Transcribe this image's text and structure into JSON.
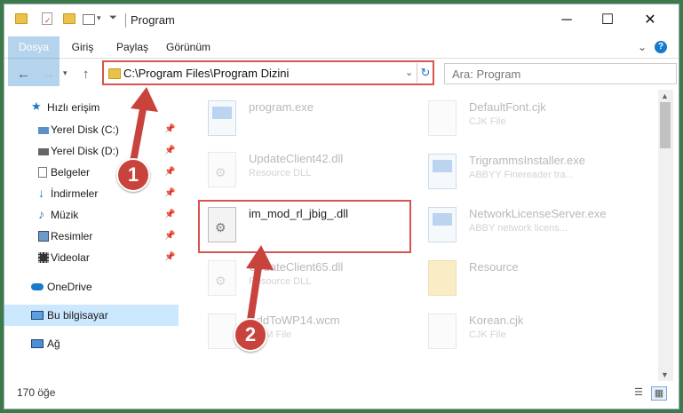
{
  "window": {
    "title": "Program",
    "buttons": {
      "minimize": "─",
      "maximize": "☐",
      "close": "✕"
    }
  },
  "ribbon": {
    "tabs": [
      {
        "label": "Dosya"
      },
      {
        "label": "Giriş"
      },
      {
        "label": "Paylaş"
      },
      {
        "label": "Görünüm"
      }
    ],
    "expand_icon": "⌄",
    "help_icon": "?"
  },
  "address": {
    "path": "C:\\Program Files\\Program Dizini",
    "search_placeholder": "Ara: Program"
  },
  "sidebar": {
    "items": [
      {
        "label": "Hızlı erişim",
        "icon": "star-icon"
      },
      {
        "label": "Yerel Disk (C:)",
        "icon": "drive-icon"
      },
      {
        "label": "Yerel Disk (D:)",
        "icon": "drive-icon"
      },
      {
        "label": "Belgeler",
        "icon": "documents-icon"
      },
      {
        "label": "İndirmeler",
        "icon": "download-icon"
      },
      {
        "label": "Müzik",
        "icon": "music-icon"
      },
      {
        "label": "Resimler",
        "icon": "pictures-icon"
      },
      {
        "label": "Videolar",
        "icon": "videos-icon"
      },
      {
        "label": "OneDrive",
        "icon": "cloud-icon"
      },
      {
        "label": "Bu bilgisayar",
        "icon": "computer-icon"
      },
      {
        "label": "Ağ",
        "icon": "network-icon"
      }
    ]
  },
  "files": {
    "left": [
      {
        "name": "program.exe",
        "desc": ""
      },
      {
        "name": "UpdateClient42.dll",
        "desc": "Resource DLL"
      },
      {
        "name": "im_mod_rl_jbig_.dll",
        "desc": ""
      },
      {
        "name": "UpdateClient65.dll",
        "desc": "Resource DLL"
      },
      {
        "name": "AddToWP14.wcm",
        "desc": "WCM File"
      }
    ],
    "right": [
      {
        "name": "DefaultFont.cjk",
        "desc": "CJK File"
      },
      {
        "name": "TrigrammsInstaller.exe",
        "desc": "ABBYY Finereader tra..."
      },
      {
        "name": "NetworkLicenseServer.exe",
        "desc": "ABBY network licens..."
      },
      {
        "name": "Resource",
        "desc": ""
      },
      {
        "name": "Korean.cjk",
        "desc": "CJK File"
      }
    ]
  },
  "status": {
    "count": "170 öğe"
  },
  "callouts": {
    "one": "1",
    "two": "2"
  },
  "colors": {
    "accent": "#1979ca",
    "highlight": "#d9534f",
    "badge": "#c9433d"
  }
}
